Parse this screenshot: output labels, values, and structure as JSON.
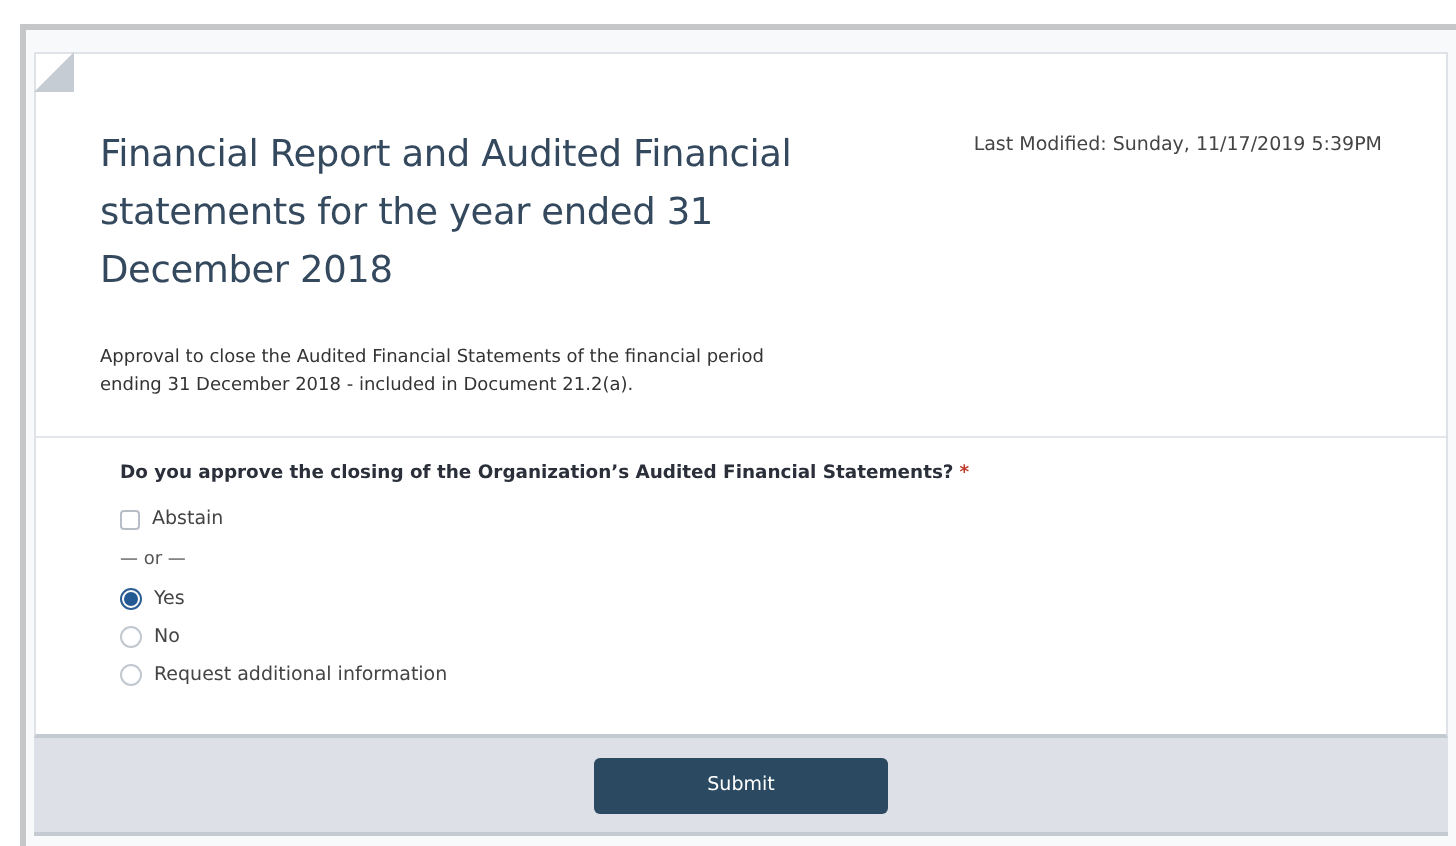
{
  "title": "Financial Report and Audited Financial statements for the year ended 31 December 2018",
  "last_modified": "Last Modified: Sunday, 11/17/2019 5:39PM",
  "description": "Approval to close the Audited Financial Statements of the financial period ending 31 December 2018 - included in Document 21.2(a).",
  "question": {
    "label": "Do you approve the closing of the Organization’s Audited Financial Statements?",
    "required_mark": "*"
  },
  "options": [
    {
      "kind": "checkbox",
      "label": "Abstain",
      "checked": false
    },
    {
      "kind": "separator",
      "label": "— or —"
    },
    {
      "kind": "radio",
      "label": "Yes",
      "selected": true
    },
    {
      "kind": "radio",
      "label": "No",
      "selected": false
    },
    {
      "kind": "radio",
      "label": "Request additional information",
      "selected": false
    }
  ],
  "submit_button": "Submit"
}
